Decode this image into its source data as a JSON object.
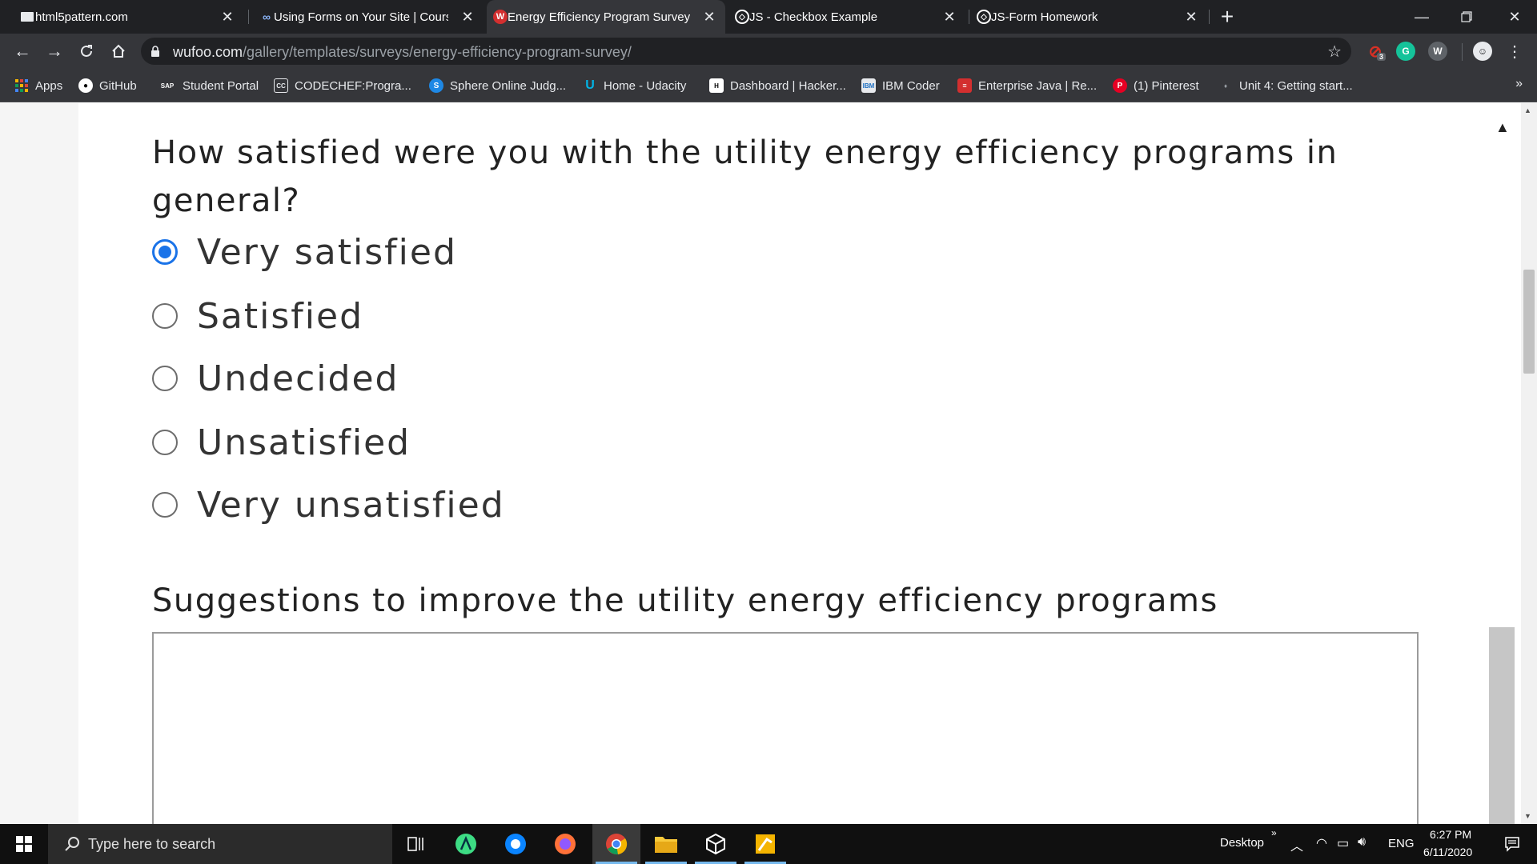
{
  "tabs": [
    {
      "title": "html5pattern.com",
      "icon": "page-icon",
      "active": false
    },
    {
      "title": "Using Forms on Your Site | Cours",
      "icon": "codecademy-icon",
      "active": false
    },
    {
      "title": "Energy Efficiency Program Survey",
      "icon": "wufoo-icon",
      "active": true
    },
    {
      "title": "JS - Checkbox Example",
      "icon": "codepen-icon",
      "active": false
    },
    {
      "title": "JS-Form Homework",
      "icon": "codepen-icon",
      "active": false
    }
  ],
  "address_bar": {
    "host": "wufoo.com",
    "path": "/gallery/templates/surveys/energy-efficiency-program-survey/"
  },
  "extensions": [
    {
      "name": "extension-badge-icon",
      "badge": "3",
      "color": "#d93025"
    },
    {
      "name": "grammarly-icon",
      "label": "G",
      "color": "#15c39a"
    },
    {
      "name": "w-extension-icon",
      "label": "W",
      "color": "#5f6368"
    }
  ],
  "bookmarks": [
    {
      "label": "Apps",
      "icon": "apps-grid-icon"
    },
    {
      "label": "GitHub",
      "icon": "github-icon"
    },
    {
      "label": "Student Portal",
      "icon": "sap-icon"
    },
    {
      "label": "CODECHEF:Progra...",
      "icon": "codechef-icon"
    },
    {
      "label": "Sphere Online Judg...",
      "icon": "spoj-icon"
    },
    {
      "label": "Home - Udacity",
      "icon": "udacity-icon"
    },
    {
      "label": "Dashboard | Hacker...",
      "icon": "hackerrank-icon"
    },
    {
      "label": "IBM Coder",
      "icon": "ibm-icon"
    },
    {
      "label": "Enterprise Java | Re...",
      "icon": "java-icon"
    },
    {
      "label": "(1) Pinterest",
      "icon": "pinterest-icon"
    },
    {
      "label": "Unit 4: Getting start...",
      "icon": "bullet-icon"
    }
  ],
  "survey": {
    "question1": "How satisfied were you with the utility energy efficiency programs in general?",
    "options": [
      {
        "label": "Very satisfied",
        "checked": true
      },
      {
        "label": "Satisfied",
        "checked": false
      },
      {
        "label": "Undecided",
        "checked": false
      },
      {
        "label": "Unsatisfied",
        "checked": false
      },
      {
        "label": "Very unsatisfied",
        "checked": false
      }
    ],
    "question2": "Suggestions to improve the utility energy efficiency programs",
    "suggestions_value": ""
  },
  "taskbar": {
    "search_placeholder": "Type here to search",
    "desktop_label": "Desktop",
    "language": "ENG",
    "time": "6:27 PM",
    "date": "6/11/2020"
  },
  "colors": {
    "accent": "#1a73e8",
    "chrome_dark": "#202124",
    "chrome_toolbar": "#35363a"
  }
}
